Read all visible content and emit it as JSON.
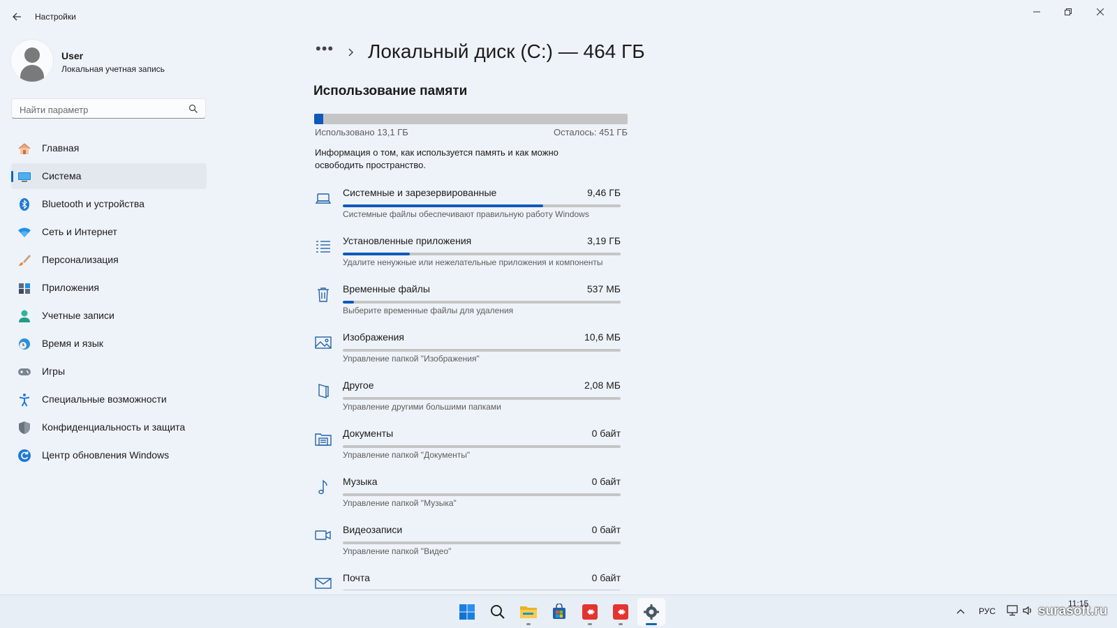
{
  "app": {
    "title": "Настройки"
  },
  "profile": {
    "name": "User",
    "account_type": "Локальная учетная запись"
  },
  "search": {
    "placeholder": "Найти параметр"
  },
  "nav": {
    "items": [
      {
        "label": "Главная",
        "icon": "home-icon",
        "active": false
      },
      {
        "label": "Система",
        "icon": "system-icon",
        "active": true
      },
      {
        "label": "Bluetooth и устройства",
        "icon": "bluetooth-icon",
        "active": false
      },
      {
        "label": "Сеть и Интернет",
        "icon": "wifi-icon",
        "active": false
      },
      {
        "label": "Персонализация",
        "icon": "brush-icon",
        "active": false
      },
      {
        "label": "Приложения",
        "icon": "apps-icon",
        "active": false
      },
      {
        "label": "Учетные записи",
        "icon": "accounts-icon",
        "active": false
      },
      {
        "label": "Время и язык",
        "icon": "time-language-icon",
        "active": false
      },
      {
        "label": "Игры",
        "icon": "gamepad-icon",
        "active": false
      },
      {
        "label": "Специальные возможности",
        "icon": "accessibility-icon",
        "active": false
      },
      {
        "label": "Конфиденциальность и защита",
        "icon": "shield-icon",
        "active": false
      },
      {
        "label": "Центр обновления Windows",
        "icon": "update-icon",
        "active": false
      }
    ]
  },
  "breadcrumb": {
    "more": "•••",
    "title": "Локальный диск (C:) — 464 ГБ"
  },
  "storage": {
    "section_title": "Использование памяти",
    "used_label": "Использовано 13,1 ГБ",
    "left_label": "Осталось: 451 ГБ",
    "used_fraction": 0.028,
    "info": "Информация о том, как используется память и как можно освободить пространство.",
    "categories": [
      {
        "name": "Системные и зарезервированные",
        "size": "9,46 ГБ",
        "desc": "Системные файлы обеспечивают правильную работу Windows",
        "fraction": 0.72,
        "icon": "laptop-icon"
      },
      {
        "name": "Установленные приложения",
        "size": "3,19 ГБ",
        "desc": "Удалите ненужные или нежелательные приложения и компоненты",
        "fraction": 0.24,
        "icon": "list-icon"
      },
      {
        "name": "Временные файлы",
        "size": "537 МБ",
        "desc": "Выберите временные файлы для удаления",
        "fraction": 0.04,
        "icon": "trash-icon"
      },
      {
        "name": "Изображения",
        "size": "10,6 МБ",
        "desc": "Управление папкой \"Изображения\"",
        "fraction": 0.0,
        "icon": "picture-icon"
      },
      {
        "name": "Другое",
        "size": "2,08 МБ",
        "desc": "Управление другими большими папками",
        "fraction": 0.0,
        "icon": "folder-other-icon"
      },
      {
        "name": "Документы",
        "size": "0 байт",
        "desc": "Управление папкой \"Документы\"",
        "fraction": 0.0,
        "icon": "documents-icon"
      },
      {
        "name": "Музыка",
        "size": "0 байт",
        "desc": "Управление папкой \"Музыка\"",
        "fraction": 0.0,
        "icon": "music-icon"
      },
      {
        "name": "Видеозаписи",
        "size": "0 байт",
        "desc": "Управление папкой \"Видео\"",
        "fraction": 0.0,
        "icon": "video-icon"
      },
      {
        "name": "Почта",
        "size": "0 байт",
        "desc": "",
        "fraction": 0.0,
        "icon": "mail-icon"
      }
    ]
  },
  "taskbar": {
    "apps": [
      "start-icon",
      "search-icon",
      "file-explorer-icon",
      "store-icon",
      "anydesk-icon",
      "anydesk-icon",
      "settings-icon"
    ],
    "lang": "РУС",
    "time": "11:15",
    "watermark": "surasoft.ru"
  },
  "colors": {
    "accent": "#0067c0",
    "bar_fill": "#0f5ab8",
    "bar_track": "#c5c5c5",
    "background": "#eef3f9"
  }
}
